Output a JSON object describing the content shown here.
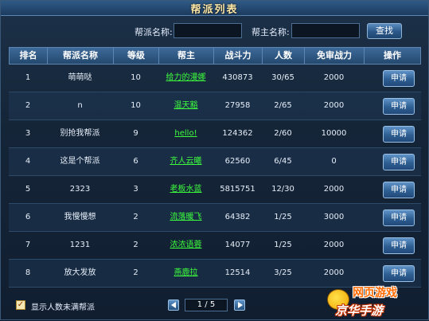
{
  "window": {
    "title": "帮派列表"
  },
  "search": {
    "guild_label": "帮派名称:",
    "guild_value": "",
    "leader_label": "帮主名称:",
    "leader_value": "",
    "button": "查找"
  },
  "table": {
    "headers": [
      "排名",
      "帮派名称",
      "等级",
      "帮主",
      "战斗力",
      "人数",
      "免审战力",
      "操作"
    ],
    "rows": [
      {
        "rank": "1",
        "name": "萌萌哒",
        "level": "10",
        "leader": "给力的漫娜",
        "power": "430873",
        "members": "30/65",
        "free_power": "2000",
        "action": "申请"
      },
      {
        "rank": "2",
        "name": "n",
        "level": "10",
        "leader": "温天豁",
        "power": "27958",
        "members": "2/65",
        "free_power": "2000",
        "action": "申请"
      },
      {
        "rank": "3",
        "name": "别抢我帮派",
        "level": "9",
        "leader": "hello!",
        "power": "124362",
        "members": "2/60",
        "free_power": "10000",
        "action": "申请"
      },
      {
        "rank": "4",
        "name": "这是个帮派",
        "level": "6",
        "leader": "齐人云曦",
        "power": "62560",
        "members": "6/45",
        "free_power": "0",
        "action": "申请"
      },
      {
        "rank": "5",
        "name": "2323",
        "level": "3",
        "leader": "老板水蓝",
        "power": "5815751",
        "members": "12/30",
        "free_power": "2000",
        "action": "申请"
      },
      {
        "rank": "6",
        "name": "我慢慢想",
        "level": "2",
        "leader": "流落暖飞",
        "power": "64382",
        "members": "1/25",
        "free_power": "3000",
        "action": "申请"
      },
      {
        "rank": "7",
        "name": "1231",
        "level": "2",
        "leader": "浓浓语蓉",
        "power": "14077",
        "members": "1/25",
        "free_power": "2000",
        "action": "申请"
      },
      {
        "rank": "8",
        "name": "放大发放",
        "level": "2",
        "leader": "燕鹿拉",
        "power": "12514",
        "members": "3/25",
        "free_power": "2000",
        "action": "申请"
      }
    ]
  },
  "footer": {
    "checkbox_checked": true,
    "checkbox_label": "显示人数未满帮派",
    "page": "1 / 5"
  },
  "watermark": {
    "line1": "网页游戏",
    "line2": "京华手游"
  },
  "colors": {
    "leader_link": "#3dff3d",
    "title": "#ffe9a8",
    "panel": "#152538"
  }
}
